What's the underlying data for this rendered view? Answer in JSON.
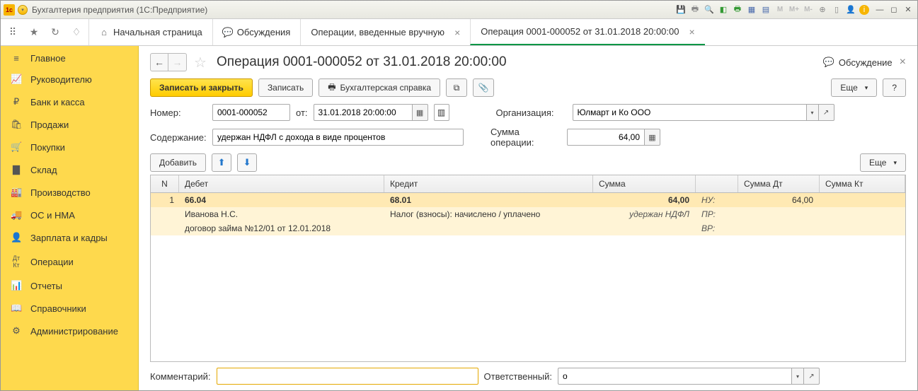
{
  "window_title": "Бухгалтерия предприятия  (1С:Предприятие)",
  "top_icons": {
    "m1": "M",
    "m2": "M+",
    "m3": "M-"
  },
  "tabs": {
    "home": "Начальная страница",
    "discussions": "Обсуждения",
    "manual_ops": "Операции, введенные вручную",
    "current": "Операция 0001-000052 от 31.01.2018 20:00:00"
  },
  "sidebar": [
    {
      "label": "Главное"
    },
    {
      "label": "Руководителю"
    },
    {
      "label": "Банк и касса"
    },
    {
      "label": "Продажи"
    },
    {
      "label": "Покупки"
    },
    {
      "label": "Склад"
    },
    {
      "label": "Производство"
    },
    {
      "label": "ОС и НМА"
    },
    {
      "label": "Зарплата и кадры"
    },
    {
      "label": "Операции"
    },
    {
      "label": "Отчеты"
    },
    {
      "label": "Справочники"
    },
    {
      "label": "Администрирование"
    }
  ],
  "page": {
    "title": "Операция 0001-000052 от 31.01.2018 20:00:00",
    "discuss": "Обсуждение",
    "toolbar": {
      "save_close": "Записать и закрыть",
      "save": "Записать",
      "print": "Бухгалтерская справка",
      "more": "Еще",
      "help": "?"
    },
    "form": {
      "number_label": "Номер:",
      "number": "0001-000052",
      "from_label": "от:",
      "date": "31.01.2018 20:00:00",
      "org_label": "Организация:",
      "org": "Юлмарт и Ко ООО",
      "content_label": "Содержание:",
      "content": "удержан НДФЛ с дохода в виде процентов",
      "sum_label": "Сумма операции:",
      "sum": "64,00"
    },
    "table_toolbar": {
      "add": "Добавить",
      "more": "Еще"
    },
    "grid": {
      "headers": {
        "n": "N",
        "debit": "Дебет",
        "credit": "Кредит",
        "sum": "Сумма",
        "sumdt": "Сумма Дт",
        "sumkt": "Сумма Кт"
      },
      "row": {
        "n": "1",
        "deb_acct": "66.04",
        "cred_acct": "68.01",
        "sum": "64,00",
        "nu": "НУ:",
        "sumdt": "64,00",
        "deb_sub1": "Иванова Н.С.",
        "cred_sub1": "Налог (взносы): начислено / уплачено",
        "note": "удержан НДФЛ",
        "pr": "ПР:",
        "deb_sub2": "договор займа №12/01 от 12.01.2018",
        "vr": "ВР:"
      }
    },
    "footer": {
      "comment_label": "Комментарий:",
      "comment": "",
      "resp_label": "Ответственный:",
      "resp": "o"
    }
  }
}
